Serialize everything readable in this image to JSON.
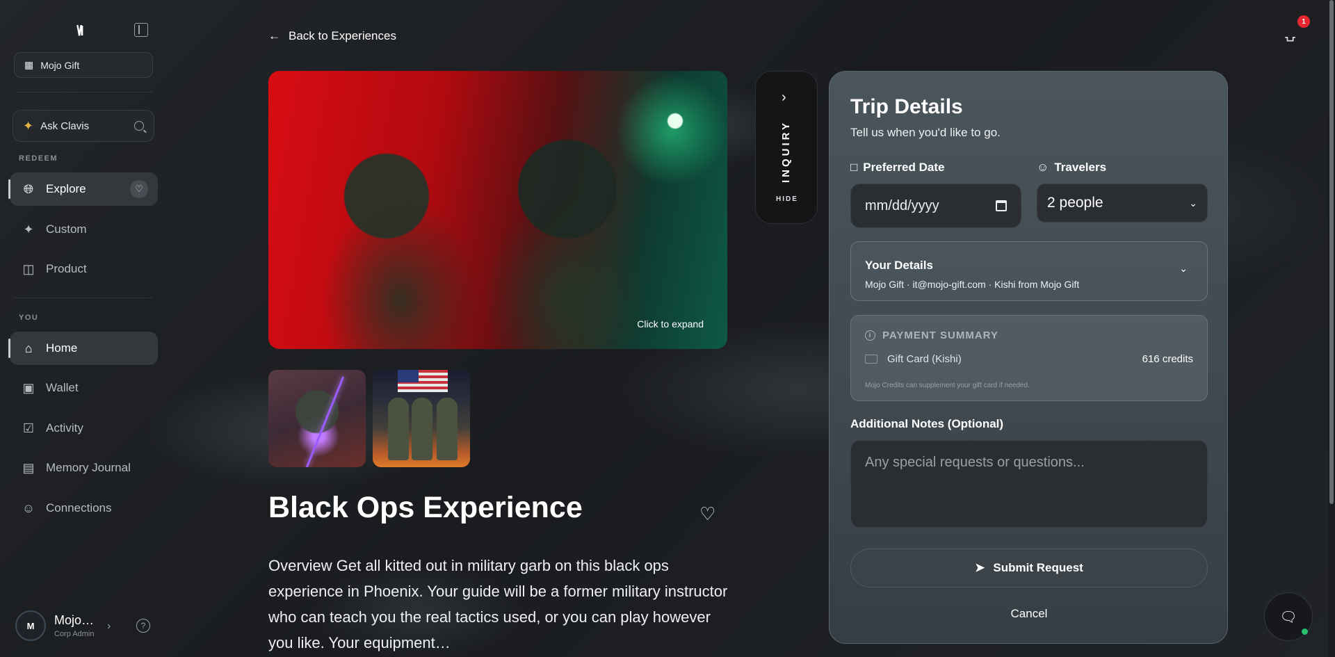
{
  "sidebar": {
    "logo": "\\/I",
    "org": "Mojo Gift",
    "ask": "Ask Clavis",
    "sections": {
      "redeem": "REDEEM",
      "you": "YOU"
    },
    "redeem_items": [
      {
        "label": "Explore",
        "icon": "globe-icon"
      },
      {
        "label": "Custom",
        "icon": "sparkle-icon"
      },
      {
        "label": "Product",
        "icon": "gift-icon"
      }
    ],
    "you_items": [
      {
        "label": "Home",
        "icon": "home-icon"
      },
      {
        "label": "Wallet",
        "icon": "wallet-icon"
      },
      {
        "label": "Activity",
        "icon": "calendar-icon"
      },
      {
        "label": "Memory Journal",
        "icon": "book-icon"
      },
      {
        "label": "Connections",
        "icon": "users-icon"
      }
    ],
    "user": {
      "initial": "M",
      "name": "Mojo…",
      "role": "Corp Admin"
    }
  },
  "main": {
    "back": "Back to Experiences",
    "hero_caption": "Click to expand",
    "title": "Black Ops Experience",
    "description": "Overview Get all kitted out in military garb on this black ops experience in Phoenix. Your guide will be a former military instructor who can teach you the real tactics used, or you can play however you like. Your equipment…"
  },
  "inquiry": {
    "label": "INQUIRY",
    "hide": "HIDE"
  },
  "trip": {
    "title": "Trip Details",
    "subtitle": "Tell us when you'd like to go.",
    "date_label": "Preferred Date",
    "date_placeholder": "mm/dd/yyyy",
    "travelers_label": "Travelers",
    "travelers_value": "2 people",
    "details_heading": "Your Details",
    "details_summary": "Mojo Gift · it@mojo-gift.com · Kishi from Mojo Gift",
    "payment_heading": "PAYMENT SUMMARY",
    "payment_method": "Gift Card (Kishi)",
    "payment_credits": "616 credits",
    "payment_note": "Mojo Credits can supplement your gift card if needed.",
    "notes_label": "Additional Notes (Optional)",
    "notes_placeholder": "Any special requests or questions...",
    "submit": "Submit Request",
    "cancel": "Cancel"
  },
  "notifications": {
    "count": "1"
  },
  "colors": {
    "badge": "#e3262f",
    "online": "#27c06d",
    "panel": "#4a555c"
  }
}
